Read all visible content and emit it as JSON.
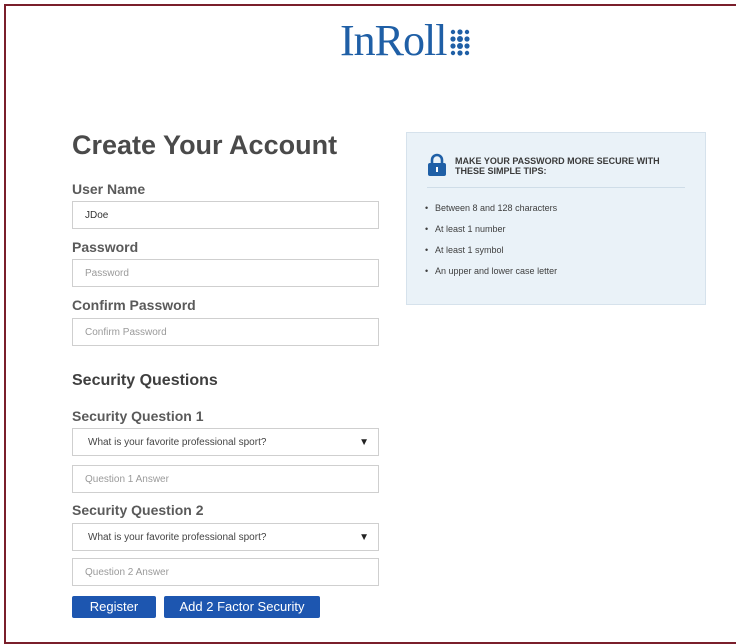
{
  "brand": {
    "name": "InRoll",
    "accent": "#1f5fa6"
  },
  "form": {
    "title": "Create Your Account",
    "username": {
      "label": "User Name",
      "value": "JDoe"
    },
    "password": {
      "label": "Password",
      "placeholder": "Password"
    },
    "confirm_password": {
      "label": "Confirm Password",
      "placeholder": "Confirm Password"
    },
    "security_section_title": "Security Questions",
    "q1": {
      "label": "Security Question 1",
      "selected": "What is your favorite professional sport?",
      "answer_placeholder": "Question 1 Answer"
    },
    "q2": {
      "label": "Security Question 2",
      "selected": "What is your favorite professional sport?",
      "answer_placeholder": "Question 2 Answer"
    },
    "register_label": "Register",
    "two_factor_label": "Add 2 Factor Security"
  },
  "tips": {
    "icon": "lock-icon",
    "title": "MAKE YOUR PASSWORD MORE SECURE WITH THESE SIMPLE TIPS:",
    "items": [
      "Between 8 and 128 characters",
      "At least 1 number",
      "At least 1 symbol",
      "An upper and lower case letter"
    ]
  },
  "colors": {
    "frame": "#7a1f2b",
    "button": "#1d56b0",
    "tips_bg": "#eaf2f8"
  }
}
